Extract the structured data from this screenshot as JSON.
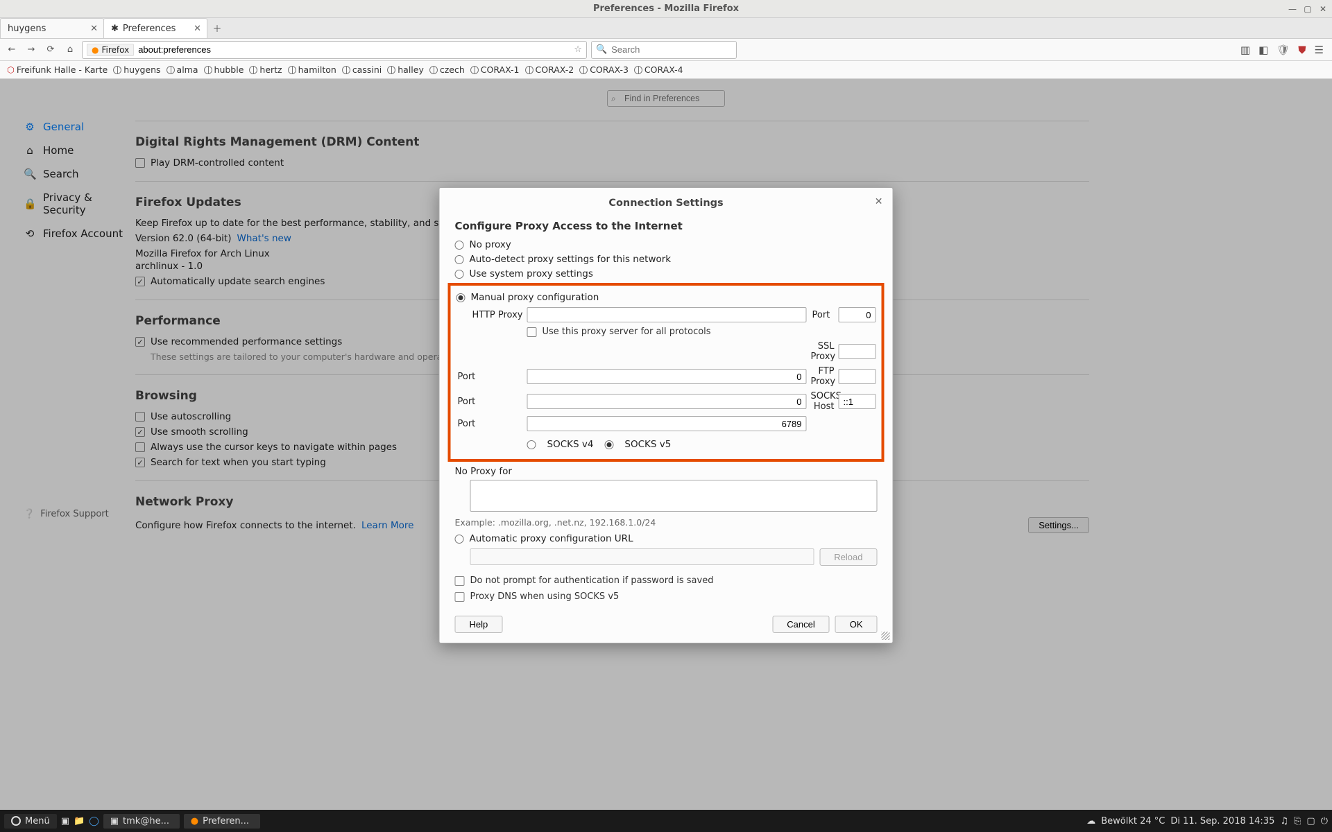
{
  "window": {
    "title": "Preferences - Mozilla Firefox"
  },
  "tabs": [
    {
      "label": "huygens"
    },
    {
      "label": "Preferences"
    }
  ],
  "urlbar": {
    "identity": "Firefox",
    "url": "about:preferences"
  },
  "searchbox": {
    "placeholder": "Search"
  },
  "bookmarks": [
    "Freifunk Halle - Karte",
    "huygens",
    "alma",
    "hubble",
    "hertz",
    "hamilton",
    "cassini",
    "halley",
    "czech",
    "CORAX-1",
    "CORAX-2",
    "CORAX-3",
    "CORAX-4"
  ],
  "findbar": {
    "placeholder": "Find in Preferences"
  },
  "sidebar": {
    "items": [
      "General",
      "Home",
      "Search",
      "Privacy & Security",
      "Firefox Account"
    ],
    "support": "Firefox Support"
  },
  "prefs": {
    "drm_title": "Digital Rights Management (DRM) Content",
    "drm_check": "Play DRM-controlled content",
    "updates_title": "Firefox Updates",
    "updates_keep": "Keep Firefox up to date for the best performance, stability, and security.",
    "version": "Version 62.0 (64-bit)",
    "whatsnew": "What's new",
    "distro1": "Mozilla Firefox for Arch Linux",
    "distro2": "archlinux - 1.0",
    "auto_update": "Automatically update search engines",
    "perf_title": "Performance",
    "perf_rec": "Use recommended performance settings",
    "perf_hint": "These settings are tailored to your computer's hardware and operating system.",
    "browsing_title": "Browsing",
    "autoscroll": "Use autoscrolling",
    "smooth": "Use smooth scrolling",
    "cursor": "Always use the cursor keys to navigate within pages",
    "searchtext": "Search for text when you start typing",
    "netproxy_title": "Network Proxy",
    "netproxy_desc": "Configure how Firefox connects to the internet.",
    "learn_more": "Learn More",
    "settings_btn": "Settings..."
  },
  "modal": {
    "title": "Connection Settings",
    "section": "Configure Proxy Access to the Internet",
    "no_proxy": "No proxy",
    "auto_detect": "Auto-detect proxy settings for this network",
    "use_system": "Use system proxy settings",
    "manual": "Manual proxy configuration",
    "http_label": "HTTP Proxy",
    "port_label": "Port",
    "http_port": "0",
    "use_all": "Use this proxy server for all protocols",
    "ssl_label": "SSL Proxy",
    "ssl_port": "0",
    "ftp_label": "FTP Proxy",
    "ftp_port": "0",
    "socks_label": "SOCKS Host",
    "socks_host": "::1",
    "socks_port": "6789",
    "socks_v4": "SOCKS v4",
    "socks_v5": "SOCKS v5",
    "no_proxy_for": "No Proxy for",
    "example": "Example: .mozilla.org, .net.nz, 192.168.1.0/24",
    "auto_url": "Automatic proxy configuration URL",
    "reload": "Reload",
    "no_prompt": "Do not prompt for authentication if password is saved",
    "proxy_dns": "Proxy DNS when using SOCKS v5",
    "help": "Help",
    "cancel": "Cancel",
    "ok": "OK"
  },
  "taskbar": {
    "menu": "Menü",
    "tasks": [
      "tmk@he...",
      "Preferen..."
    ],
    "weather": "Bewölkt 24 °C",
    "datetime": "Di 11. Sep. 2018 14:35"
  }
}
